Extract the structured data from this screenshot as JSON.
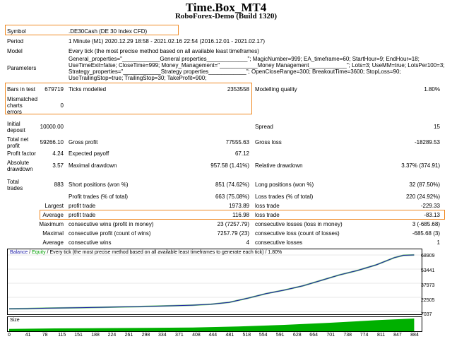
{
  "header": {
    "title": "Time.Box_MT4",
    "subtitle": "RoboForex-Demo (Build 1320)"
  },
  "info": {
    "symbol_label": "Symbol",
    "symbol_value": ".DE30Cash (DE 30 Index CFD)",
    "period_label": "Period",
    "period_value": "1 Minute (M1) 2020.12.29 18:58 - 2021.02.16 22:54 (2016.12.01 - 2021.02.17)",
    "model_label": "Model",
    "model_value": "Every tick (the most precise method based on all available least timeframes)",
    "parameters_label": "Parameters",
    "parameters_lines": [
      "General_properties=\"____________General properties_____________\"; MagicNumber=999; EA_timeframe=60; StartHour=9; EndHour=18;",
      "UseTimeExit=false; CloseTime=999; Money_Management=\"____________Money Management____________\"; Lots=3; UseMM=true; LotsPer100=3;",
      "Strategy_properties=\"____________Strategy properties____________\"; OpenCloseRange=300; BreakoutTime=3600; StopLoss=90;",
      "UseTrailingStop=true; TrailingStop=30; TakeProfit=900;"
    ]
  },
  "stats": {
    "bars_label": "Bars in test",
    "bars_value": "679719",
    "ticks_label": "Ticks modelled",
    "ticks_value": "2353558",
    "quality_label": "Modelling quality",
    "quality_value": "1.80%",
    "mismatch_label_lines": [
      "Mismatched",
      "charts",
      "errors"
    ],
    "mismatch_value": "0",
    "deposit_label_lines": [
      "Initial",
      "deposit"
    ],
    "deposit_value": "10000.00",
    "spread_label": "Spread",
    "spread_value": "15",
    "netprofit_label_lines": [
      "Total net",
      "profit"
    ],
    "netprofit_value": "59266.10",
    "grossprofit_label": "Gross profit",
    "grossprofit_value": "77555.63",
    "grossloss_label": "Gross loss",
    "grossloss_value": "-18289.53",
    "pf_label": "Profit factor",
    "pf_value": "4.24",
    "payoff_label": "Expected payoff",
    "payoff_value": "67.12",
    "absdd_label_lines": [
      "Absolute",
      "drawdown"
    ],
    "absdd_value": "3.57",
    "maxdd_label": "Maximal drawdown",
    "maxdd_value": "957.58 (1.41%)",
    "reldd_label": "Relative drawdown",
    "reldd_value": "3.37% (374.91)",
    "trades_label_lines": [
      "Total",
      "trades"
    ],
    "trades_value": "883",
    "short_label": "Short positions (won %)",
    "short_value": "851 (74.62%)",
    "long_label": "Long positions (won %)",
    "long_value": "32 (87.50%)",
    "profittrades_label": "Profit trades (% of total)",
    "profittrades_value": "663 (75.08%)",
    "losstrades_label": "Loss trades (% of total)",
    "losstrades_value": "220 (24.92%)",
    "largest_label": "Largest",
    "largest_profit_label": "profit trade",
    "largest_profit_value": "1973.89",
    "largest_loss_label": "loss trade",
    "largest_loss_value": "-229.33",
    "average_label": "Average",
    "average_profit_label": "profit trade",
    "average_profit_value": "116.98",
    "average_loss_label": "loss trade",
    "average_loss_value": "-83.13",
    "maximum_label": "Maximum",
    "max_wins_label": "consecutive wins (profit in money)",
    "max_wins_value": "23 (7257.79)",
    "max_losses_label": "consecutive losses (loss in money)",
    "max_losses_value": "3 (-685.68)",
    "maximal_label": "Maximal",
    "maximal_wins_label": "consecutive profit (count of wins)",
    "maximal_wins_value": "7257.79 (23)",
    "maximal_losses_label": "consecutive loss (count of losses)",
    "maximal_losses_value": "-685.68 (3)",
    "avg2_label": "Average",
    "avg_wins_label": "consecutive wins",
    "avg_wins_value": "4",
    "avg_losses_label": "consecutive losses",
    "avg_losses_value": "1"
  },
  "chart": {
    "legend_balance": "Balance",
    "legend_sep": " / ",
    "legend_equity": "Equity",
    "legend_rest": " / Every tick (the most precise method based on all available least timeframes to generate each tick) / 1.80%",
    "size_label": "Size",
    "balance_color": "#1a1aa6",
    "equity_color": "#00a000",
    "size_color": "#00b000"
  },
  "chart_data": {
    "type": "line",
    "ylim": [
      7037,
      68909
    ],
    "yticks": [
      "68909",
      "53441",
      "37973",
      "22505",
      "7037"
    ],
    "xticks": [
      "0",
      "41",
      "78",
      "115",
      "151",
      "188",
      "224",
      "261",
      "298",
      "334",
      "371",
      "408",
      "444",
      "481",
      "518",
      "554",
      "591",
      "628",
      "664",
      "701",
      "738",
      "774",
      "811",
      "847",
      "884"
    ],
    "series": [
      {
        "name": "Balance",
        "x": [
          0,
          40,
          80,
          120,
          160,
          200,
          240,
          280,
          320,
          360,
          400,
          440,
          480,
          520,
          560,
          600,
          640,
          680,
          720,
          760,
          800,
          840,
          860,
          883
        ],
        "values": [
          10000,
          10100,
          10600,
          10900,
          11200,
          11600,
          12000,
          12300,
          12800,
          13300,
          13900,
          14900,
          17000,
          21500,
          26500,
          30500,
          35000,
          41000,
          47000,
          52000,
          58000,
          66000,
          68500,
          68909
        ]
      }
    ],
    "size_series": {
      "x": [
        0,
        100,
        200,
        300,
        400,
        500,
        600,
        700,
        800,
        883
      ],
      "values": [
        0.16,
        0.2,
        0.22,
        0.24,
        0.26,
        0.34,
        0.45,
        0.6,
        0.78,
        0.9
      ]
    }
  }
}
